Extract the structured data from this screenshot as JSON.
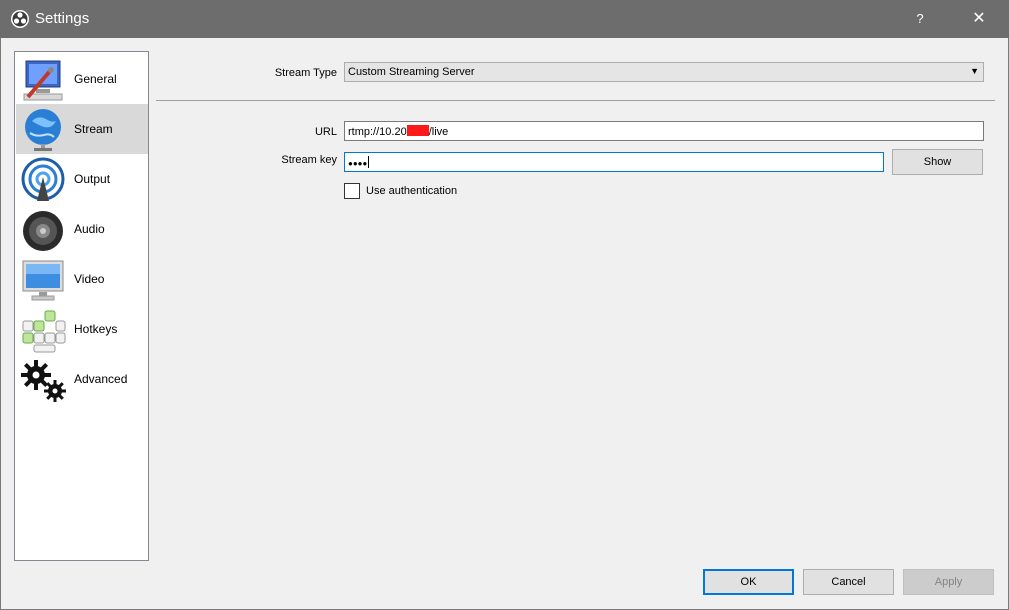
{
  "window": {
    "title": "Settings",
    "help_glyph": "?",
    "close_glyph": "✕"
  },
  "sidebar": {
    "items": [
      {
        "label": "General",
        "icon": "general-icon"
      },
      {
        "label": "Stream",
        "icon": "stream-icon"
      },
      {
        "label": "Output",
        "icon": "output-icon"
      },
      {
        "label": "Audio",
        "icon": "audio-icon"
      },
      {
        "label": "Video",
        "icon": "video-icon"
      },
      {
        "label": "Hotkeys",
        "icon": "hotkeys-icon"
      },
      {
        "label": "Advanced",
        "icon": "advanced-icon"
      }
    ],
    "selected": "Stream"
  },
  "stream": {
    "stream_type_label": "Stream Type",
    "stream_type_value": "Custom Streaming Server",
    "url_label": "URL",
    "url_prefix": "rtmp://10.20",
    "url_suffix": "/live",
    "stream_key_label": "Stream key",
    "stream_key_value": "●●●●",
    "show_label": "Show",
    "auth_label": "Use authentication",
    "auth_checked": false
  },
  "buttons": {
    "ok": "OK",
    "cancel": "Cancel",
    "apply": "Apply"
  },
  "colors": {
    "titlebar": "#6d6d6d",
    "accent": "#0078d7",
    "selected_item": "#d9d9d9",
    "redaction": "#ff1a1a"
  }
}
